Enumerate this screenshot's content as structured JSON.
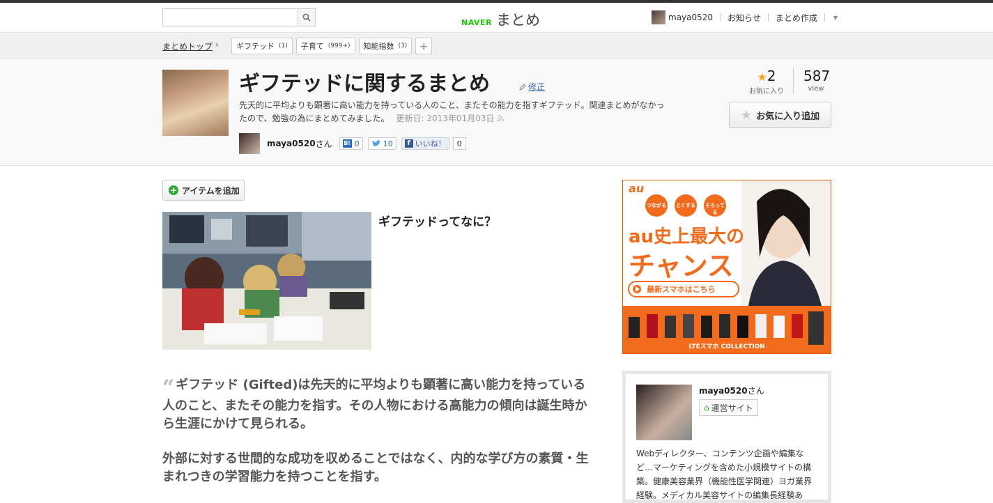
{
  "header": {
    "search_placeholder": "",
    "logo_naver": "NAVER",
    "logo_matome": "まとめ",
    "username": "maya0520",
    "notifications": "お知らせ",
    "create": "まとめ作成"
  },
  "breadcrumb": {
    "top": "まとめトップ",
    "tags": [
      {
        "label": "ギフテッド",
        "count": "(1)"
      },
      {
        "label": "子育て",
        "count": "(999+)"
      },
      {
        "label": "知能指数",
        "count": "(3)"
      }
    ],
    "add": "+"
  },
  "title_area": {
    "title": "ギフテッドに関するまとめ",
    "edit": "修正",
    "description": "先天的に平均よりも顕著に高い能力を持っている人のこと、またその能力を指すギフテッド。関連まとめがなかったので、勉強の為にまとめてみました。",
    "updated": "更新日: 2013年01月03日",
    "author": "maya0520",
    "san": "さん",
    "hatena_count": "0",
    "tweet_count": "10",
    "like_label": "いいね！",
    "like_count": "0",
    "fav_count": "2",
    "fav_label": "お気に入り",
    "view_count": "587",
    "view_label": "view",
    "fav_button": "お気に入り追加"
  },
  "content": {
    "add_item": "アイテムを追加",
    "item_title": "ギフテッドってなに？",
    "quote1": "ギフテッド (Gifted)は先天的に平均よりも顕著に高い能力を持っている人のこと、またその能力を指す。その人物における高能力の傾向は誕生時から生涯にかけて見られる。",
    "quote2": "外部に対する世間的な成功を収めることではなく、内的な学び方の素質・生まれつきの学習能力を持つことを指す。"
  },
  "ad": {
    "brand": "au",
    "bubble1": "つながる",
    "bubble2": "とくする",
    "bubble3": "そろってる",
    "headline1": "au史上最大の",
    "headline2": "チャンス",
    "cta": "最新スマホはこちら",
    "footer": "LTEスマホ COLLECTION"
  },
  "profile": {
    "name": "maya0520",
    "san": "さん",
    "site_button": "運営サイト",
    "description": "Webディレクター、コンテンツ企画や編集など…マーケティングを含めた小規模サイトの構築。健康美容業界（機能性医学関連）ヨガ業界経験。メディカル美容サイトの編集長経験あ"
  }
}
